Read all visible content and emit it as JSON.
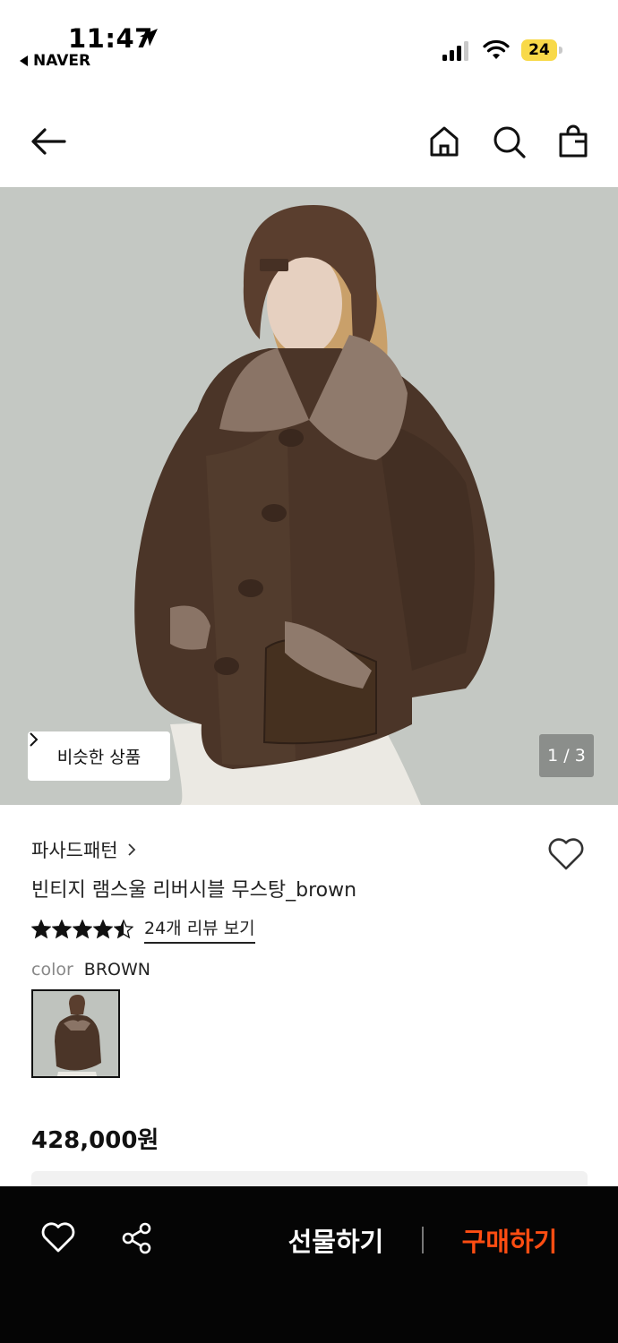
{
  "status_bar": {
    "time": "11:47",
    "back_app": "NAVER",
    "battery": "24",
    "icons": [
      "location-arrow-icon",
      "signal-icon",
      "wifi-icon",
      "battery-icon"
    ]
  },
  "nav": {
    "icons": [
      "back-arrow-icon",
      "home-icon",
      "search-icon",
      "shopping-bag-icon"
    ]
  },
  "gallery": {
    "similar_button": "비슷한 상품",
    "page_indicator": "1 / 3"
  },
  "product": {
    "brand": "파사드패턴",
    "name": "빈티지 램스울 리버시블 무스탕_brown",
    "rating": 4.5,
    "review_link": "24개 리뷰 보기",
    "option_label": "color",
    "option_value": "BROWN",
    "price": "428,000원"
  },
  "bottom_bar": {
    "gift": "선물하기",
    "buy": "구매하기"
  },
  "colors": {
    "accent": "#ff4d12",
    "bottom_bar": "#050505",
    "battery": "#f8d949"
  }
}
